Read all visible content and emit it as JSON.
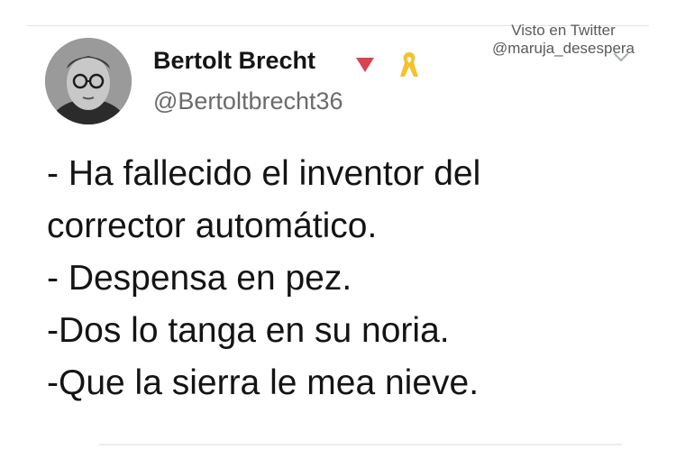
{
  "watermark": {
    "line1": "Visto en Twitter",
    "line2": "@maruja_desespera"
  },
  "author": {
    "name": "Bertolt Brecht",
    "handle": "@Bertoltbrecht36"
  },
  "tweet": {
    "lines": [
      "- Ha fallecido el inventor del",
      "corrector automático.",
      "- Despensa en pez.",
      "-Dos lo tanga en su noria.",
      "-Que la sierra le mea nieve."
    ]
  },
  "icons": {
    "avatar": "profile-photo",
    "badge": "red-triangle-icon",
    "ribbon": "yellow-ribbon-icon",
    "menu": "chevron-down-icon"
  },
  "colors": {
    "badge": "#d64550",
    "ribbon": "#f2c230",
    "handle": "#6b6b6b",
    "text": "#141414"
  }
}
